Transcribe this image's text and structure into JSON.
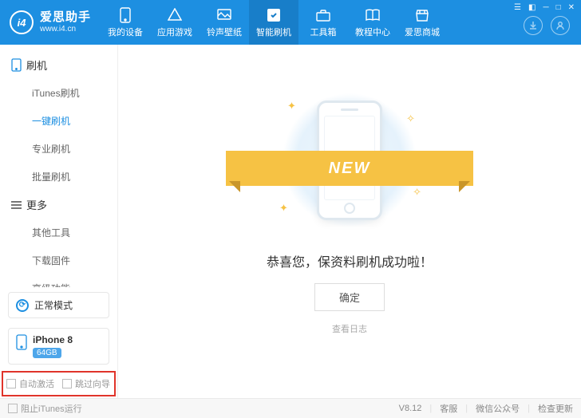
{
  "brand": {
    "title": "爱思助手",
    "subtitle": "www.i4.cn",
    "logo_text": "i4"
  },
  "nav": [
    {
      "label": "我的设备"
    },
    {
      "label": "应用游戏"
    },
    {
      "label": "铃声壁纸"
    },
    {
      "label": "智能刷机"
    },
    {
      "label": "工具箱"
    },
    {
      "label": "教程中心"
    },
    {
      "label": "爱思商城"
    }
  ],
  "sidebar": {
    "group1": {
      "title": "刷机",
      "items": [
        "iTunes刷机",
        "一键刷机",
        "专业刷机",
        "批量刷机"
      ]
    },
    "group2": {
      "title": "更多",
      "items": [
        "其他工具",
        "下载固件",
        "高级功能"
      ]
    }
  },
  "mode_label": "正常模式",
  "device": {
    "name": "iPhone 8",
    "storage": "64GB"
  },
  "checks": {
    "auto_activate": "自动激活",
    "skip_guide": "跳过向导",
    "block_itunes": "阻止iTunes运行"
  },
  "main": {
    "ribbon": "NEW",
    "success": "恭喜您，保资料刷机成功啦！",
    "ok": "确定",
    "log": "查看日志"
  },
  "footer": {
    "version": "V8.12",
    "support": "客服",
    "wechat": "微信公众号",
    "update": "检查更新"
  }
}
